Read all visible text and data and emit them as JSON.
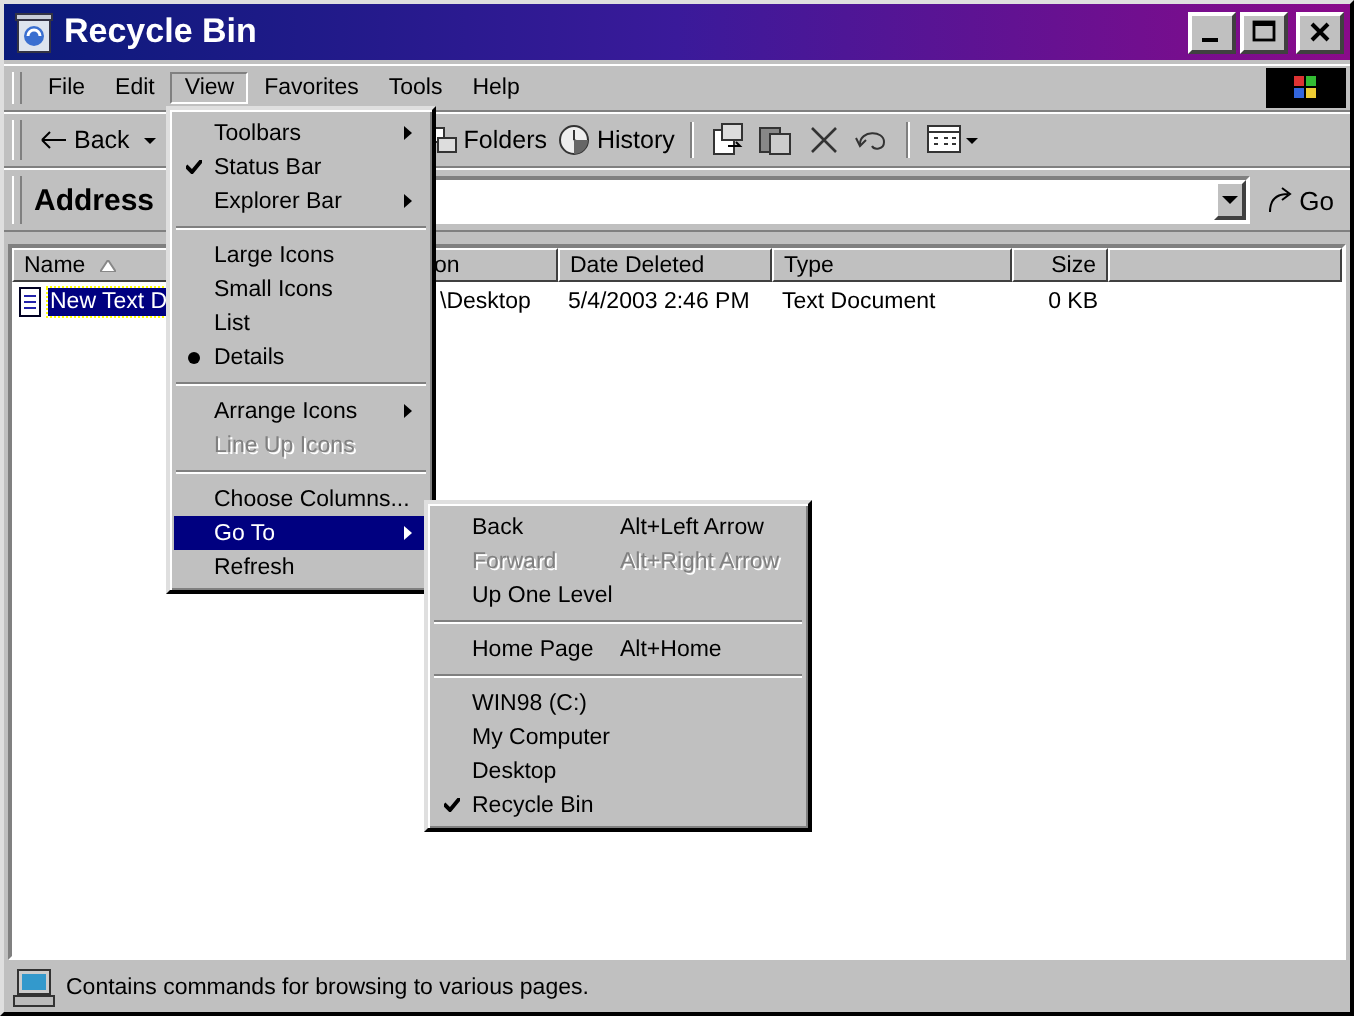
{
  "window": {
    "title": "Recycle Bin"
  },
  "menu_bar": [
    {
      "label": "File",
      "selected": false
    },
    {
      "label": "Edit",
      "selected": false
    },
    {
      "label": "View",
      "selected": true
    },
    {
      "label": "Favorites",
      "selected": false
    },
    {
      "label": "Tools",
      "selected": false
    },
    {
      "label": "Help",
      "selected": false
    }
  ],
  "toolbar": {
    "back": "Back",
    "folders": "Folders",
    "history": "History"
  },
  "address": {
    "label": "Address",
    "go": "Go"
  },
  "list": {
    "columns": [
      {
        "label": "Name",
        "sorted": true
      },
      {
        "label": "on",
        "sorted": false
      },
      {
        "label": "Date Deleted",
        "sorted": false
      },
      {
        "label": "Type",
        "sorted": false
      },
      {
        "label": "Size",
        "sorted": false
      }
    ],
    "rows": [
      {
        "cells": [
          "New Text D",
          "\\Desktop",
          "5/4/2003 2:46 PM",
          "Text Document",
          "0 KB"
        ],
        "selected": true
      }
    ]
  },
  "view_menu": [
    {
      "kind": "item",
      "label": "Toolbars",
      "disabled": false,
      "selected": false,
      "submenu": true
    },
    {
      "kind": "check",
      "label": "Status Bar",
      "checked": true,
      "disabled": false,
      "selected": false,
      "submenu": false
    },
    {
      "kind": "item",
      "label": "Explorer Bar",
      "disabled": false,
      "selected": false,
      "submenu": true
    },
    {
      "kind": "separator"
    },
    {
      "kind": "radio",
      "label": "Large Icons",
      "checked": false,
      "disabled": false,
      "selected": false,
      "submenu": false
    },
    {
      "kind": "radio",
      "label": "Small Icons",
      "checked": false,
      "disabled": false,
      "selected": false,
      "submenu": false
    },
    {
      "kind": "radio",
      "label": "List",
      "checked": false,
      "disabled": false,
      "selected": false,
      "submenu": false
    },
    {
      "kind": "radio",
      "label": "Details",
      "checked": true,
      "disabled": false,
      "selected": false,
      "submenu": false
    },
    {
      "kind": "separator"
    },
    {
      "kind": "item",
      "label": "Arrange Icons",
      "disabled": false,
      "selected": false,
      "submenu": true
    },
    {
      "kind": "item",
      "label": "Line Up Icons",
      "disabled": true,
      "selected": false,
      "submenu": false
    },
    {
      "kind": "separator"
    },
    {
      "kind": "item",
      "label": "Choose Columns...",
      "disabled": false,
      "selected": false,
      "submenu": false
    },
    {
      "kind": "item",
      "label": "Go To",
      "disabled": false,
      "selected": true,
      "submenu": true
    },
    {
      "kind": "item",
      "label": "Refresh",
      "disabled": false,
      "selected": false,
      "submenu": false
    }
  ],
  "go_to_menu": [
    {
      "kind": "item",
      "label": "Back",
      "shortcut": "Alt+Left Arrow",
      "disabled": false,
      "selected": false,
      "submenu": false
    },
    {
      "kind": "item",
      "label": "Forward",
      "shortcut": "Alt+Right Arrow",
      "disabled": true,
      "selected": false,
      "submenu": false
    },
    {
      "kind": "item",
      "label": "Up One Level",
      "disabled": false,
      "selected": false,
      "submenu": false
    },
    {
      "kind": "separator"
    },
    {
      "kind": "item",
      "label": "Home Page",
      "shortcut": "Alt+Home",
      "disabled": false,
      "selected": false,
      "submenu": false
    },
    {
      "kind": "separator"
    },
    {
      "kind": "check",
      "label": "WIN98 (C:)",
      "checked": false,
      "disabled": false,
      "selected": false,
      "submenu": false
    },
    {
      "kind": "check",
      "label": "My Computer",
      "checked": false,
      "disabled": false,
      "selected": false,
      "submenu": false
    },
    {
      "kind": "check",
      "label": "Desktop",
      "checked": false,
      "disabled": false,
      "selected": false,
      "submenu": false
    },
    {
      "kind": "check",
      "label": "Recycle Bin",
      "checked": true,
      "disabled": false,
      "selected": false,
      "submenu": false
    }
  ],
  "status_bar": {
    "text": "Contains commands for browsing to various pages."
  }
}
